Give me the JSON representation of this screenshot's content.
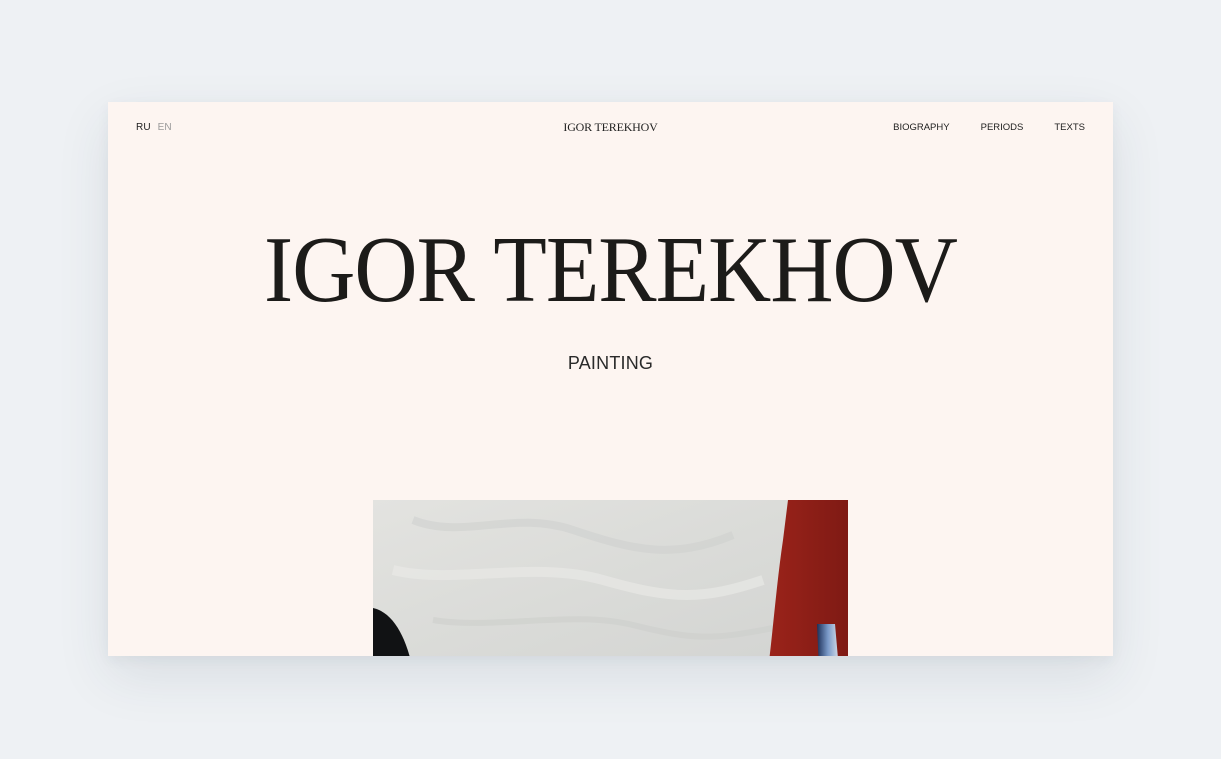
{
  "header": {
    "languages": [
      {
        "label": "RU",
        "active": true
      },
      {
        "label": "EN",
        "active": false
      }
    ],
    "logo": "IGOR TEREKHOV",
    "nav": [
      {
        "label": "BIOGRAPHY"
      },
      {
        "label": "PERIODS"
      },
      {
        "label": "TEXTS"
      }
    ]
  },
  "hero": {
    "title": "IGOR TEREKHOV",
    "subtitle": "PAINTING"
  },
  "colors": {
    "page_background": "#eef1f4",
    "content_background": "#fdf5f1",
    "text": "#1c1b19",
    "inactive_lang": "#9a9a9a",
    "painting_red": "#8e1e17",
    "painting_white": "#dfdfdc"
  }
}
